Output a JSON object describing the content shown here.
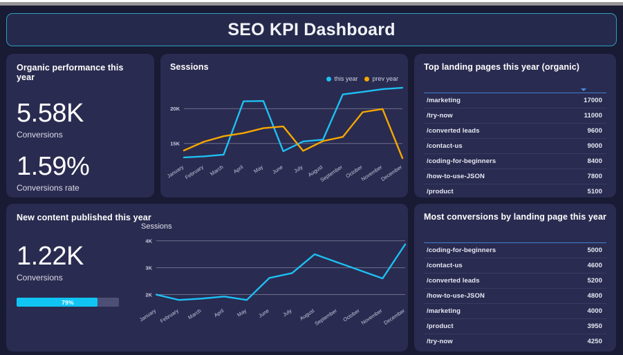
{
  "header": {
    "title": "SEO KPI Dashboard",
    "border_color": "#2b9fbd"
  },
  "colors": {
    "page_bg": "#191a33",
    "card_bg": "#2a2b50",
    "this_year": "#1ec0f3",
    "prev_year": "#f5a800",
    "accent_cyan": "#10c5f4",
    "table_header_rule": "#3f7fd0"
  },
  "organic_performance": {
    "title": "Organic performance this year",
    "conversions_value": "5.58K",
    "conversions_label": "Conversions",
    "rate_value": "1.59%",
    "rate_label": "Conversions rate"
  },
  "sessions_card": {
    "title": "Sessions",
    "legend": [
      {
        "label": "this year",
        "color": "#1ec0f3"
      },
      {
        "label": "prev year",
        "color": "#f5a800"
      }
    ]
  },
  "new_content": {
    "title": "New content published this year",
    "conversions_value": "1.22K",
    "conversions_label": "Conversions",
    "progress_percent": 79,
    "progress_label": "79%",
    "chart_axis_title": "Sessions"
  },
  "top_landing_pages": {
    "title": "Top landing pages this year (organic)",
    "header_label": "",
    "sort_icon": "caret-down-icon",
    "rows": [
      {
        "page": "/marketing",
        "value": "17000"
      },
      {
        "page": "/try-now",
        "value": "11000"
      },
      {
        "page": "/converted leads",
        "value": "9600"
      },
      {
        "page": "/contact-us",
        "value": "9000"
      },
      {
        "page": "/coding-for-beginners",
        "value": "8400"
      },
      {
        "page": "/how-to-use-JSON",
        "value": "7800"
      },
      {
        "page": "/product",
        "value": "5100"
      }
    ]
  },
  "most_conversions": {
    "title": "Most conversions by landing page this year",
    "header_label": "",
    "rows": [
      {
        "page": "/coding-for-beginners",
        "value": "5000"
      },
      {
        "page": "/contact-us",
        "value": "4600"
      },
      {
        "page": "/converted leads",
        "value": "5200"
      },
      {
        "page": "/how-to-use-JSON",
        "value": "4800"
      },
      {
        "page": "/marketing",
        "value": "4000"
      },
      {
        "page": "/product",
        "value": "3950"
      },
      {
        "page": "/try-now",
        "value": "4250"
      }
    ]
  },
  "chart_data": [
    {
      "id": "sessions_year_over_year",
      "type": "line",
      "title": "Sessions",
      "xlabel": "",
      "ylabel": "",
      "categories": [
        "January",
        "February",
        "March",
        "April",
        "May",
        "June",
        "July",
        "August",
        "September",
        "October",
        "November",
        "December"
      ],
      "yticks": [
        15000,
        20000
      ],
      "ytick_labels": [
        "15K",
        "20K"
      ],
      "ylim": [
        12800,
        23500
      ],
      "grid": true,
      "legend_position": "top-right",
      "series": [
        {
          "name": "this year",
          "color": "#1ec0f3",
          "values": [
            13000,
            13150,
            13400,
            21050,
            21100,
            13900,
            15300,
            15550,
            22050,
            22400,
            22800,
            23000
          ]
        },
        {
          "name": "prev year",
          "color": "#f5a800",
          "values": [
            14000,
            15250,
            16050,
            16500,
            17200,
            17450,
            13950,
            15350,
            15950,
            19500,
            19950,
            12900
          ]
        }
      ]
    },
    {
      "id": "new_content_sessions",
      "type": "line",
      "title": "Sessions",
      "xlabel": "",
      "ylabel": "",
      "categories": [
        "January",
        "February",
        "March",
        "April",
        "May",
        "June",
        "July",
        "August",
        "September",
        "October",
        "November",
        "December"
      ],
      "yticks": [
        2000,
        3000,
        4000
      ],
      "ytick_labels": [
        "2K",
        "3K",
        "4K"
      ],
      "ylim": [
        1680,
        4120
      ],
      "grid": true,
      "series": [
        {
          "name": "Sessions",
          "color": "#1ec0f3",
          "values": [
            2000,
            1800,
            1850,
            1930,
            1800,
            2620,
            2800,
            3500,
            3200,
            2900,
            2600,
            3870
          ]
        }
      ]
    }
  ]
}
